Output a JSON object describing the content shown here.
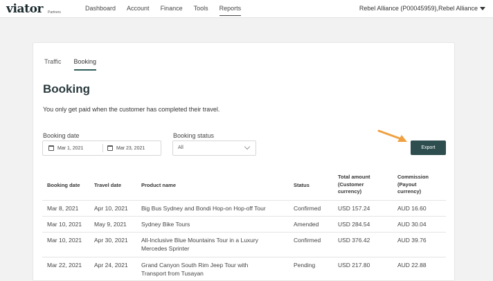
{
  "brand": {
    "name": "viator",
    "sub": "Partners"
  },
  "nav": [
    {
      "label": "Dashboard",
      "active": false
    },
    {
      "label": "Account",
      "active": false
    },
    {
      "label": "Finance",
      "active": false
    },
    {
      "label": "Tools",
      "active": false
    },
    {
      "label": "Reports",
      "active": true
    }
  ],
  "account": {
    "label": "Rebel Alliance (P00045959),Rebel Alliance"
  },
  "tabs": [
    {
      "label": "Traffic",
      "active": false
    },
    {
      "label": "Booking",
      "active": true
    }
  ],
  "page": {
    "title": "Booking",
    "subtitle": "You only get paid when the customer has completed their travel."
  },
  "filters": {
    "booking_date_label": "Booking date",
    "date_from": "Mar 1, 2021",
    "date_to": "Mar 23, 2021",
    "status_label": "Booking status",
    "status_value": "All",
    "export_label": "Export"
  },
  "table": {
    "headers": {
      "booking_date": "Booking date",
      "travel_date": "Travel date",
      "product": "Product name",
      "status": "Status",
      "total": [
        "Total amount",
        "(Customer",
        "currency)"
      ],
      "commission": [
        "Commission",
        "(Payout",
        "currency)"
      ]
    },
    "rows": [
      {
        "booking_date": "Mar 8, 2021",
        "travel_date": "Apr 10, 2021",
        "product": [
          "Big Bus Sydney and Bondi Hop-on Hop-off Tour"
        ],
        "status": "Confirmed",
        "total": "USD 157.24",
        "commission": "AUD 16.60"
      },
      {
        "booking_date": "Mar 10, 2021",
        "travel_date": "May 9, 2021",
        "product": [
          "Sydney Bike Tours"
        ],
        "status": "Amended",
        "total": "USD 284.54",
        "commission": "AUD 30.04"
      },
      {
        "booking_date": "Mar 10, 2021",
        "travel_date": "Apr 30, 2021",
        "product": [
          "All-Inclusive Blue Mountains Tour in a Luxury",
          "Mercedes Sprinter"
        ],
        "status": "Confirmed",
        "total": "USD 376.42",
        "commission": "AUD 39.76"
      },
      {
        "booking_date": "Mar 22, 2021",
        "travel_date": "Apr 24, 2021",
        "product": [
          "Grand Canyon South Rim Jeep Tour with",
          "Transport from Tusayan"
        ],
        "status": "Pending",
        "total": "USD 217.80",
        "commission": "AUD 22.88"
      }
    ]
  },
  "colors": {
    "accent": "#2e4d4e",
    "arrow": "#f0a040"
  }
}
